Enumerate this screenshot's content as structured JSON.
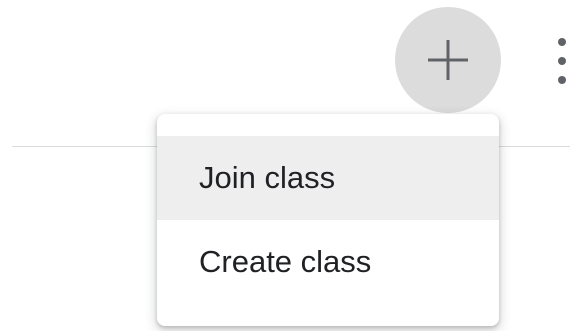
{
  "toolbar": {
    "add_icon": "plus-icon",
    "more_icon": "more-vert-icon",
    "add_button_color": "#dcdcdc",
    "icon_color": "#5f6368"
  },
  "menu": {
    "items": [
      {
        "label": "Join class",
        "highlighted": true
      },
      {
        "label": "Create class",
        "highlighted": false
      }
    ],
    "highlight_color": "#eeeeee"
  }
}
